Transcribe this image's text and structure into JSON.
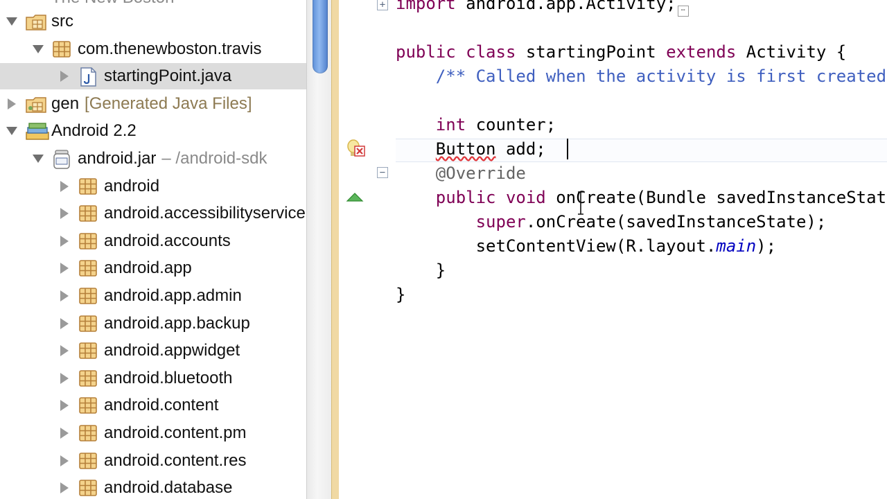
{
  "explorer": {
    "top_partial_label": "The New Boston",
    "rows": [
      {
        "key": "src",
        "label": "src",
        "sub": "",
        "dim": "",
        "expanded": true,
        "indent": 0,
        "icon": "source-folder-icon",
        "selected": false
      },
      {
        "key": "pkg",
        "label": "com.thenewboston.travis",
        "sub": "",
        "dim": "",
        "expanded": true,
        "indent": 1,
        "icon": "package-icon",
        "selected": false
      },
      {
        "key": "java",
        "label": "startingPoint.java",
        "sub": "",
        "dim": "",
        "expanded": false,
        "indent": 2,
        "icon": "java-file-icon",
        "selected": true
      },
      {
        "key": "gen",
        "label": "gen",
        "sub": "[Generated Java Files]",
        "dim": "",
        "expanded": false,
        "indent": 0,
        "icon": "generated-folder-icon",
        "selected": false
      },
      {
        "key": "android22",
        "label": "Android 2.2",
        "sub": "",
        "dim": "",
        "expanded": true,
        "indent": 0,
        "icon": "library-icon",
        "selected": false
      },
      {
        "key": "jar",
        "label": "android.jar",
        "sub": "",
        "dim": "– /android-sdk",
        "expanded": true,
        "indent": 1,
        "icon": "jar-icon",
        "selected": false
      },
      {
        "key": "p1",
        "label": "android",
        "sub": "",
        "dim": "",
        "expanded": false,
        "indent": 2,
        "icon": "package-icon",
        "selected": false
      },
      {
        "key": "p2",
        "label": "android.accessibilityservice",
        "sub": "",
        "dim": "",
        "expanded": false,
        "indent": 2,
        "icon": "package-icon",
        "selected": false
      },
      {
        "key": "p3",
        "label": "android.accounts",
        "sub": "",
        "dim": "",
        "expanded": false,
        "indent": 2,
        "icon": "package-icon",
        "selected": false
      },
      {
        "key": "p4",
        "label": "android.app",
        "sub": "",
        "dim": "",
        "expanded": false,
        "indent": 2,
        "icon": "package-icon",
        "selected": false
      },
      {
        "key": "p5",
        "label": "android.app.admin",
        "sub": "",
        "dim": "",
        "expanded": false,
        "indent": 2,
        "icon": "package-icon",
        "selected": false
      },
      {
        "key": "p6",
        "label": "android.app.backup",
        "sub": "",
        "dim": "",
        "expanded": false,
        "indent": 2,
        "icon": "package-icon",
        "selected": false
      },
      {
        "key": "p7",
        "label": "android.appwidget",
        "sub": "",
        "dim": "",
        "expanded": false,
        "indent": 2,
        "icon": "package-icon",
        "selected": false
      },
      {
        "key": "p8",
        "label": "android.bluetooth",
        "sub": "",
        "dim": "",
        "expanded": false,
        "indent": 2,
        "icon": "package-icon",
        "selected": false
      },
      {
        "key": "p9",
        "label": "android.content",
        "sub": "",
        "dim": "",
        "expanded": false,
        "indent": 2,
        "icon": "package-icon",
        "selected": false
      },
      {
        "key": "p10",
        "label": "android.content.pm",
        "sub": "",
        "dim": "",
        "expanded": false,
        "indent": 2,
        "icon": "package-icon",
        "selected": false
      },
      {
        "key": "p11",
        "label": "android.content.res",
        "sub": "",
        "dim": "",
        "expanded": false,
        "indent": 2,
        "icon": "package-icon",
        "selected": false
      },
      {
        "key": "p12",
        "label": "android.database",
        "sub": "",
        "dim": "",
        "expanded": false,
        "indent": 2,
        "icon": "package-icon",
        "selected": false
      }
    ]
  },
  "editor": {
    "lines": [
      {
        "key": "import",
        "tokens": [
          {
            "t": "import",
            "c": "kw"
          },
          {
            "t": " android.app.Activity;"
          }
        ],
        "collapsed": true
      },
      {
        "key": "blank1",
        "tokens": []
      },
      {
        "key": "class",
        "tokens": [
          {
            "t": "public",
            "c": "kw"
          },
          {
            "t": " "
          },
          {
            "t": "class",
            "c": "kw"
          },
          {
            "t": " startingPoint "
          },
          {
            "t": "extends",
            "c": "kw"
          },
          {
            "t": " Activity {"
          }
        ]
      },
      {
        "key": "comment",
        "tokens": [
          {
            "t": "    "
          },
          {
            "t": "/** Called when the activity is first created. */",
            "c": "cm"
          }
        ]
      },
      {
        "key": "blank2",
        "tokens": []
      },
      {
        "key": "counter",
        "tokens": [
          {
            "t": "    "
          },
          {
            "t": "int",
            "c": "kw"
          },
          {
            "t": " counter;"
          }
        ]
      },
      {
        "key": "button",
        "tokens": [
          {
            "t": "    "
          },
          {
            "t": "Button",
            "c": "err"
          },
          {
            "t": " add;"
          }
        ]
      },
      {
        "key": "override",
        "tokens": [
          {
            "t": "    "
          },
          {
            "t": "@Override",
            "c": "an"
          }
        ]
      },
      {
        "key": "oncreate",
        "tokens": [
          {
            "t": "    "
          },
          {
            "t": "public",
            "c": "kw"
          },
          {
            "t": " "
          },
          {
            "t": "void",
            "c": "kw"
          },
          {
            "t": " onCreate(Bundle savedInstanceState) {"
          }
        ]
      },
      {
        "key": "super",
        "tokens": [
          {
            "t": "        "
          },
          {
            "t": "super",
            "c": "kw"
          },
          {
            "t": ".onCreate(savedInstanceState);"
          }
        ]
      },
      {
        "key": "setcontent",
        "tokens": [
          {
            "t": "        setContentView(R.layout."
          },
          {
            "t": "main",
            "c": "it"
          },
          {
            "t": ");"
          }
        ]
      },
      {
        "key": "close1",
        "tokens": [
          {
            "t": "    }"
          }
        ]
      },
      {
        "key": "close2",
        "tokens": [
          {
            "t": "}"
          }
        ]
      }
    ]
  },
  "colors": {
    "keyword": "#7f0055",
    "javadoc": "#3f5fbf",
    "annotation": "#646464",
    "field_italic": "#0000c0",
    "error_underline": "#e0383d",
    "selection_row": "#dcdcdc",
    "sash": "#f0d9a4"
  }
}
